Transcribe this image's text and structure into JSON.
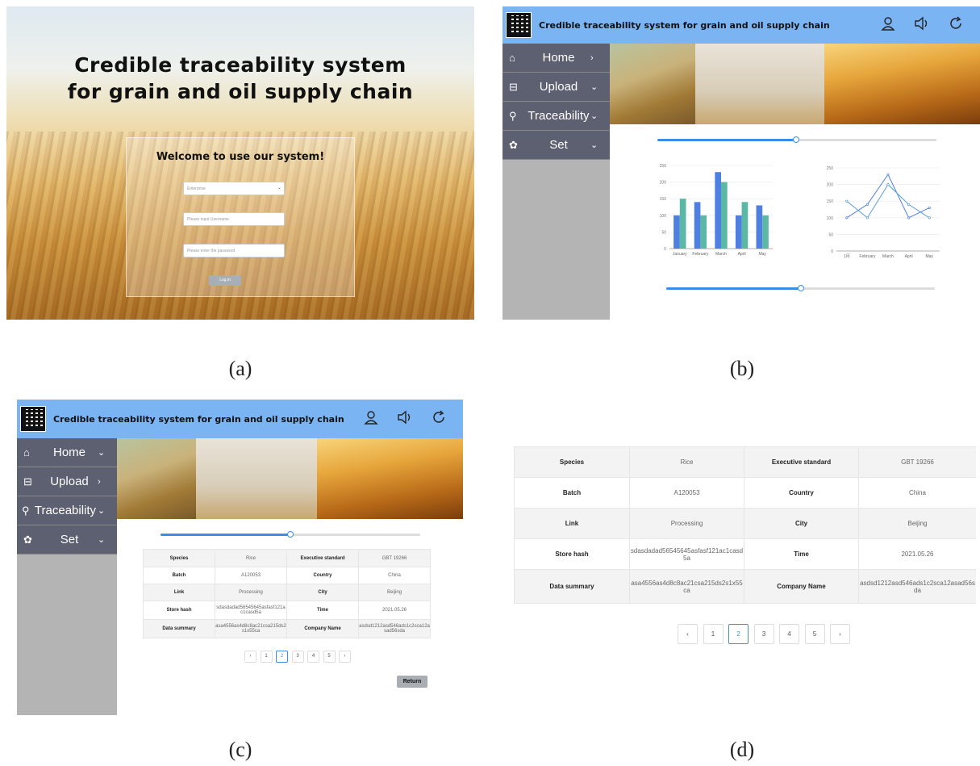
{
  "captions": [
    "(a)",
    "(b)",
    "(c)",
    "(d)"
  ],
  "app": {
    "title": "Credible traceability system for grain and oil supply chain",
    "header_icons": [
      "user-icon",
      "speaker-icon",
      "refresh-icon"
    ]
  },
  "login": {
    "title_line1": "Credible traceability system",
    "title_line2": "for grain and oil supply chain",
    "welcome": "Welcome to use our system!",
    "role_select_value": "Enterprise",
    "username_placeholder": "Please input Username",
    "password_placeholder": "Please enter the password",
    "login_button": "Log in"
  },
  "nav": {
    "home": "Home",
    "upload": "Upload",
    "traceability": "Traceability",
    "set": "Set"
  },
  "chart_data": [
    {
      "type": "bar",
      "categories": [
        "January",
        "February",
        "March",
        "April",
        "May"
      ],
      "series": [
        {
          "values": [
            100,
            140,
            230,
            100,
            130
          ],
          "color": "#4f7fe0"
        },
        {
          "values": [
            150,
            100,
            200,
            140,
            100
          ],
          "color": "#5ab8a4"
        }
      ],
      "ylim": [
        0,
        250
      ],
      "yticks": [
        "0",
        "50",
        "100",
        "150",
        "200",
        "250"
      ],
      "grid": true
    },
    {
      "type": "line",
      "categories": [
        "1月",
        "February",
        "March",
        "April",
        "May"
      ],
      "series": [
        {
          "values": [
            100,
            140,
            230,
            100,
            130
          ],
          "color": "#4f7fe0"
        },
        {
          "values": [
            150,
            100,
            200,
            140,
            100
          ],
          "color": "#5aa0d8"
        }
      ],
      "ylim": [
        0,
        250
      ],
      "yticks": [
        "0",
        "50",
        "100",
        "150",
        "200",
        "250"
      ],
      "grid": true
    }
  ],
  "trace_record": {
    "rows": [
      [
        "Species",
        "Rice",
        "Executive standard",
        "GBT 19266"
      ],
      [
        "Batch",
        "A120053",
        "Country",
        "China"
      ],
      [
        "Link",
        "Processing",
        "City",
        "Beijing"
      ],
      [
        "Store hash",
        "sdasdadad56545645asfasf121ac1casd5a",
        "Time",
        "2021.05.26"
      ],
      [
        "Data summary",
        "asa4556as4d8c8ac21csa215ds2s1x55ca",
        "Company Name",
        "asdsd1212asd546ads1c2sca12asad56sda"
      ]
    ]
  },
  "pagination": {
    "prev": "‹",
    "pages": [
      "1",
      "2",
      "3",
      "4",
      "5"
    ],
    "active": "2",
    "next": "›"
  },
  "return_button": "Return",
  "colors": {
    "header": "#7ab4f2",
    "nav": "#5c6070",
    "accent": "#3a8ee6"
  }
}
